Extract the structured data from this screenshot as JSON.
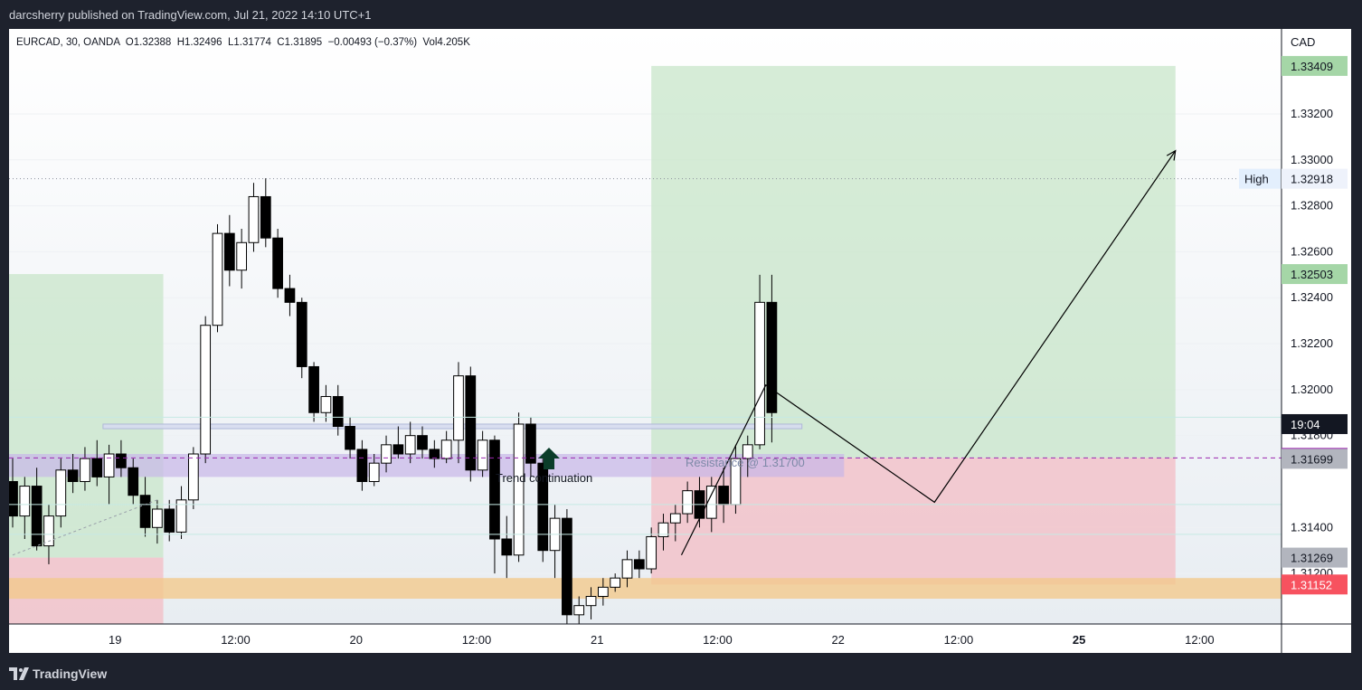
{
  "header": {
    "publish_line": "darcsherry published on TradingView.com, Jul 21, 2022 14:10 UTC+1"
  },
  "legend": {
    "symbol_line": "EURCAD, 30, OANDA  O1.32388  H1.32496  L1.31774  C1.31895  −0.00493 (−0.37%)  Vol4.205K"
  },
  "footer": {
    "brand": "TradingView"
  },
  "colors": {
    "up": "#ffffff",
    "down": "#000000",
    "profit_zone": "#c8e6c9",
    "loss_zone": "#f3bcc4",
    "demand_zone": "#f2c98c",
    "supply_zone": "#c8b6e8",
    "current_price": "#9c27b0",
    "last_label": "#131722",
    "low_label": "#f7525f",
    "grey_label": "#b2b5be",
    "green_label": "#a5d6a7"
  },
  "chart_data": {
    "type": "candlestick",
    "symbol": "EURCAD",
    "interval": "30",
    "exchange": "OANDA",
    "currency": "CAD",
    "ohlc": {
      "open": 1.32388,
      "high": 1.32496,
      "low": 1.31774,
      "close": 1.31895,
      "change": -0.00493,
      "change_pct": -0.37,
      "volume": "4.205K"
    },
    "ylim": [
      1.3098,
      1.3357
    ],
    "y_ticks": [
      1.312,
      1.314,
      1.318,
      1.32,
      1.322,
      1.324,
      1.326,
      1.328,
      1.33,
      1.332
    ],
    "x_ticks": [
      {
        "t": 2.0,
        "label": "19",
        "bold": false
      },
      {
        "t": 12.0,
        "label": "12:00",
        "bold": false
      },
      {
        "t": 22.0,
        "label": "20",
        "bold": false
      },
      {
        "t": 32.0,
        "label": "12:00",
        "bold": false
      },
      {
        "t": 42.0,
        "label": "21",
        "bold": false
      },
      {
        "t": 52.0,
        "label": "12:00",
        "bold": false
      },
      {
        "t": 62.0,
        "label": "22",
        "bold": false
      },
      {
        "t": 72.0,
        "label": "12:00",
        "bold": false
      },
      {
        "t": 82.0,
        "label": "25",
        "bold": true
      },
      {
        "t": 92.0,
        "label": "12:00",
        "bold": false
      }
    ],
    "x_range": [
      -6.8,
      98.8
    ],
    "price_labels": [
      {
        "value": 1.33409,
        "text": "1.33409",
        "style": "green"
      },
      {
        "value": 1.32918,
        "text": "1.32918",
        "style": "white",
        "tag": "High"
      },
      {
        "value": 1.32503,
        "text": "1.32503",
        "style": "green"
      },
      {
        "value": 1.3185,
        "text": "19:04",
        "style": "black"
      },
      {
        "value": 1.31703,
        "text": "1.31703",
        "style": "purple"
      },
      {
        "value": 1.31699,
        "text": "1.31699",
        "style": "grey"
      },
      {
        "value": 1.31269,
        "text": "1.31269",
        "style": "grey"
      },
      {
        "value": 1.31152,
        "text": "1.31152",
        "style": "red"
      }
    ],
    "annotations": {
      "resistance": "Resistance @ 1.31700",
      "trend": "Trend continuation",
      "high_tag": "High"
    },
    "zones": [
      {
        "kind": "profit",
        "t0": -6.8,
        "t1": 6.0,
        "y0": 1.31269,
        "y1": 1.32503
      },
      {
        "kind": "loss",
        "t0": -6.8,
        "t1": 6.0,
        "y0": 1.3098,
        "y1": 1.31269
      },
      {
        "kind": "profit",
        "t0": 46.5,
        "t1": 90.0,
        "y0": 1.31703,
        "y1": 1.33409
      },
      {
        "kind": "loss",
        "t0": 46.5,
        "t1": 90.0,
        "y0": 1.31152,
        "y1": 1.31703
      },
      {
        "kind": "demand",
        "t0": -6.8,
        "t1": 98.8,
        "y0": 1.3109,
        "y1": 1.3118
      },
      {
        "kind": "supply",
        "t0": -6.8,
        "t1": 62.5,
        "y0": 1.3162,
        "y1": 1.3172
      },
      {
        "kind": "thin",
        "t0": 1.0,
        "t1": 59.0,
        "y0": 1.3183,
        "y1": 1.3185
      }
    ],
    "projection": [
      {
        "t": 49.0,
        "y": 1.3128
      },
      {
        "t": 56.0,
        "y": 1.3202
      },
      {
        "t": 70.0,
        "y": 1.3151
      },
      {
        "t": 90.0,
        "y": 1.3304
      }
    ],
    "candles": [
      {
        "t": -6.5,
        "o": 1.316,
        "h": 1.317,
        "l": 1.314,
        "c": 1.3145
      },
      {
        "t": -5.5,
        "o": 1.3145,
        "h": 1.3162,
        "l": 1.3135,
        "c": 1.3158
      },
      {
        "t": -4.5,
        "o": 1.3158,
        "h": 1.3166,
        "l": 1.313,
        "c": 1.3132
      },
      {
        "t": -3.5,
        "o": 1.3132,
        "h": 1.315,
        "l": 1.3124,
        "c": 1.3145
      },
      {
        "t": -2.5,
        "o": 1.3145,
        "h": 1.317,
        "l": 1.314,
        "c": 1.3165
      },
      {
        "t": -1.5,
        "o": 1.3165,
        "h": 1.3172,
        "l": 1.3155,
        "c": 1.316
      },
      {
        "t": -0.5,
        "o": 1.316,
        "h": 1.3175,
        "l": 1.3156,
        "c": 1.317
      },
      {
        "t": 0.5,
        "o": 1.317,
        "h": 1.3178,
        "l": 1.3158,
        "c": 1.3162
      },
      {
        "t": 1.5,
        "o": 1.3162,
        "h": 1.3176,
        "l": 1.315,
        "c": 1.3172
      },
      {
        "t": 2.5,
        "o": 1.3172,
        "h": 1.3178,
        "l": 1.3162,
        "c": 1.3166
      },
      {
        "t": 3.5,
        "o": 1.3166,
        "h": 1.317,
        "l": 1.315,
        "c": 1.3154
      },
      {
        "t": 4.5,
        "o": 1.3154,
        "h": 1.3162,
        "l": 1.3136,
        "c": 1.314
      },
      {
        "t": 5.5,
        "o": 1.314,
        "h": 1.3152,
        "l": 1.3133,
        "c": 1.3148
      },
      {
        "t": 6.5,
        "o": 1.3148,
        "h": 1.3152,
        "l": 1.3134,
        "c": 1.3138
      },
      {
        "t": 7.5,
        "o": 1.3138,
        "h": 1.3158,
        "l": 1.3135,
        "c": 1.3152
      },
      {
        "t": 8.5,
        "o": 1.3152,
        "h": 1.3175,
        "l": 1.3148,
        "c": 1.3172
      },
      {
        "t": 9.5,
        "o": 1.3172,
        "h": 1.3232,
        "l": 1.3168,
        "c": 1.3228
      },
      {
        "t": 10.5,
        "o": 1.3228,
        "h": 1.3272,
        "l": 1.3225,
        "c": 1.3268
      },
      {
        "t": 11.5,
        "o": 1.3268,
        "h": 1.3276,
        "l": 1.3245,
        "c": 1.3252
      },
      {
        "t": 12.5,
        "o": 1.3252,
        "h": 1.327,
        "l": 1.3244,
        "c": 1.3264
      },
      {
        "t": 13.5,
        "o": 1.3264,
        "h": 1.329,
        "l": 1.326,
        "c": 1.3284
      },
      {
        "t": 14.5,
        "o": 1.3284,
        "h": 1.3292,
        "l": 1.3262,
        "c": 1.3266
      },
      {
        "t": 15.5,
        "o": 1.3266,
        "h": 1.327,
        "l": 1.324,
        "c": 1.3244
      },
      {
        "t": 16.5,
        "o": 1.3244,
        "h": 1.325,
        "l": 1.3232,
        "c": 1.3238
      },
      {
        "t": 17.5,
        "o": 1.3238,
        "h": 1.324,
        "l": 1.3205,
        "c": 1.321
      },
      {
        "t": 18.5,
        "o": 1.321,
        "h": 1.3212,
        "l": 1.3186,
        "c": 1.319
      },
      {
        "t": 19.5,
        "o": 1.319,
        "h": 1.3202,
        "l": 1.3186,
        "c": 1.3197
      },
      {
        "t": 20.5,
        "o": 1.3197,
        "h": 1.3202,
        "l": 1.318,
        "c": 1.3184
      },
      {
        "t": 21.5,
        "o": 1.3184,
        "h": 1.3188,
        "l": 1.317,
        "c": 1.3174
      },
      {
        "t": 22.5,
        "o": 1.3174,
        "h": 1.3178,
        "l": 1.3156,
        "c": 1.316
      },
      {
        "t": 23.5,
        "o": 1.316,
        "h": 1.3172,
        "l": 1.3158,
        "c": 1.3168
      },
      {
        "t": 24.5,
        "o": 1.3168,
        "h": 1.318,
        "l": 1.3164,
        "c": 1.3176
      },
      {
        "t": 25.5,
        "o": 1.3176,
        "h": 1.3184,
        "l": 1.317,
        "c": 1.3172
      },
      {
        "t": 26.5,
        "o": 1.3172,
        "h": 1.3186,
        "l": 1.3168,
        "c": 1.318
      },
      {
        "t": 27.5,
        "o": 1.318,
        "h": 1.3184,
        "l": 1.317,
        "c": 1.3174
      },
      {
        "t": 28.5,
        "o": 1.3174,
        "h": 1.3178,
        "l": 1.3166,
        "c": 1.317
      },
      {
        "t": 29.5,
        "o": 1.317,
        "h": 1.3182,
        "l": 1.3168,
        "c": 1.3178
      },
      {
        "t": 30.5,
        "o": 1.3178,
        "h": 1.3212,
        "l": 1.3168,
        "c": 1.3206
      },
      {
        "t": 31.5,
        "o": 1.3206,
        "h": 1.321,
        "l": 1.316,
        "c": 1.3165
      },
      {
        "t": 32.5,
        "o": 1.3165,
        "h": 1.3182,
        "l": 1.3162,
        "c": 1.3178
      },
      {
        "t": 33.5,
        "o": 1.3178,
        "h": 1.318,
        "l": 1.312,
        "c": 1.3135
      },
      {
        "t": 34.5,
        "o": 1.3135,
        "h": 1.3145,
        "l": 1.3118,
        "c": 1.3128
      },
      {
        "t": 35.5,
        "o": 1.3128,
        "h": 1.319,
        "l": 1.3125,
        "c": 1.3185
      },
      {
        "t": 36.5,
        "o": 1.3185,
        "h": 1.3188,
        "l": 1.3162,
        "c": 1.3168
      },
      {
        "t": 37.5,
        "o": 1.3168,
        "h": 1.317,
        "l": 1.3125,
        "c": 1.313
      },
      {
        "t": 38.5,
        "o": 1.313,
        "h": 1.315,
        "l": 1.3118,
        "c": 1.3144
      },
      {
        "t": 39.5,
        "o": 1.3144,
        "h": 1.3148,
        "l": 1.3098,
        "c": 1.3102
      },
      {
        "t": 40.5,
        "o": 1.3102,
        "h": 1.311,
        "l": 1.3098,
        "c": 1.3106
      },
      {
        "t": 41.5,
        "o": 1.3106,
        "h": 1.3114,
        "l": 1.31,
        "c": 1.311
      },
      {
        "t": 42.5,
        "o": 1.311,
        "h": 1.3118,
        "l": 1.3106,
        "c": 1.3114
      },
      {
        "t": 43.5,
        "o": 1.3114,
        "h": 1.312,
        "l": 1.3112,
        "c": 1.3118
      },
      {
        "t": 44.5,
        "o": 1.3118,
        "h": 1.313,
        "l": 1.3114,
        "c": 1.3126
      },
      {
        "t": 45.5,
        "o": 1.3126,
        "h": 1.313,
        "l": 1.3118,
        "c": 1.3122
      },
      {
        "t": 46.5,
        "o": 1.3122,
        "h": 1.314,
        "l": 1.312,
        "c": 1.3136
      },
      {
        "t": 47.5,
        "o": 1.3136,
        "h": 1.3146,
        "l": 1.313,
        "c": 1.3142
      },
      {
        "t": 48.5,
        "o": 1.3142,
        "h": 1.315,
        "l": 1.3134,
        "c": 1.3146
      },
      {
        "t": 49.5,
        "o": 1.3146,
        "h": 1.316,
        "l": 1.3142,
        "c": 1.3156
      },
      {
        "t": 50.5,
        "o": 1.3156,
        "h": 1.3162,
        "l": 1.314,
        "c": 1.3144
      },
      {
        "t": 51.5,
        "o": 1.3144,
        "h": 1.3162,
        "l": 1.3138,
        "c": 1.3158
      },
      {
        "t": 52.5,
        "o": 1.3158,
        "h": 1.3166,
        "l": 1.3142,
        "c": 1.315
      },
      {
        "t": 53.5,
        "o": 1.315,
        "h": 1.3176,
        "l": 1.3146,
        "c": 1.317
      },
      {
        "t": 54.5,
        "o": 1.317,
        "h": 1.318,
        "l": 1.3162,
        "c": 1.3176
      },
      {
        "t": 55.5,
        "o": 1.3176,
        "h": 1.325,
        "l": 1.3174,
        "c": 1.3238
      },
      {
        "t": 56.5,
        "o": 1.3238,
        "h": 1.325,
        "l": 1.3177,
        "c": 1.319
      }
    ]
  }
}
